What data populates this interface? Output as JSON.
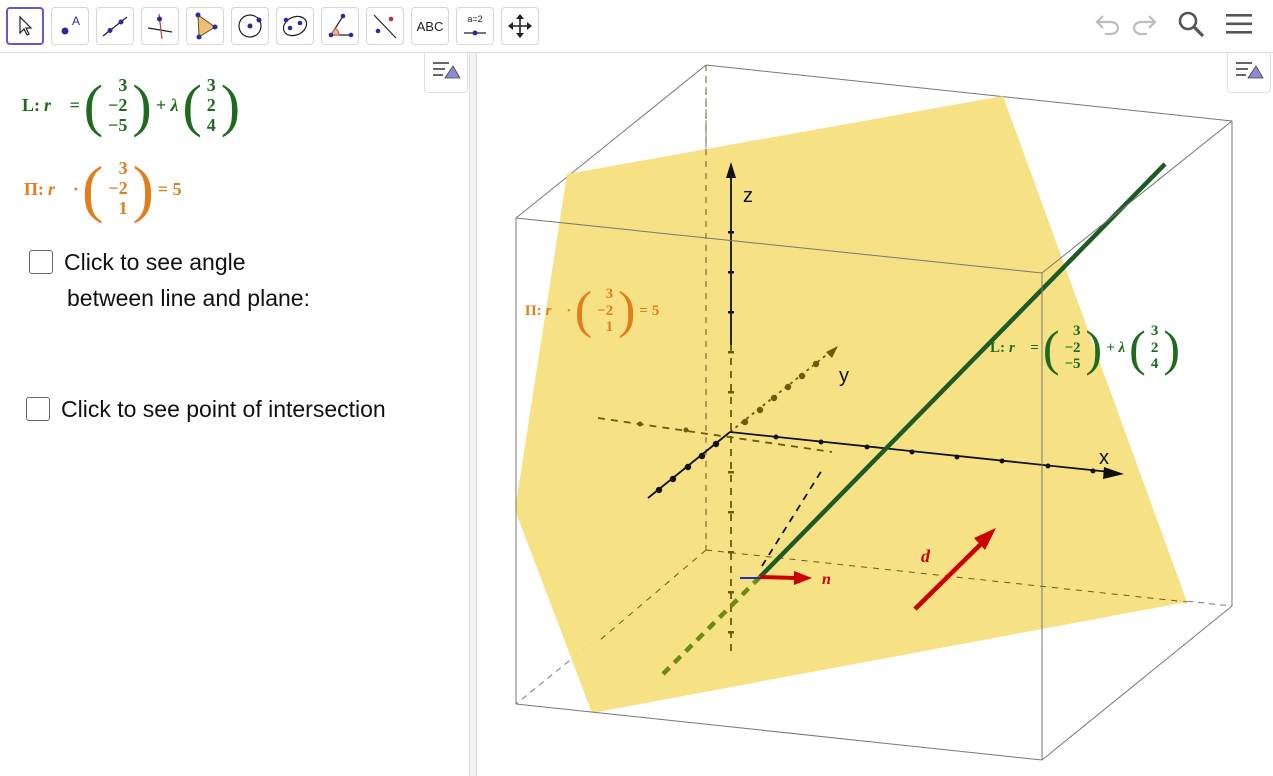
{
  "toolbar": {
    "text_tool_label": "ABC",
    "slider_tool_label": "a=2",
    "point_tool_letter": "A",
    "tools": [
      "move",
      "point",
      "line",
      "perpendicular-line",
      "polygon",
      "circle",
      "conic",
      "angle",
      "reflect",
      "text",
      "slider",
      "move-graphics-view"
    ]
  },
  "algebra": {
    "line": {
      "name": "L:",
      "lhs": "r⃗ =",
      "point": [
        "3",
        "−2",
        "−5"
      ],
      "op": "+ λ",
      "direction": [
        "3",
        "2",
        "4"
      ]
    },
    "plane": {
      "name": "Π:",
      "lhs": "r⃗ ·",
      "normal": [
        "3",
        "−2",
        "1"
      ],
      "rhs": "= 5"
    },
    "checkbox_angle": {
      "label_line1": "Click to see angle",
      "label_line2": "between line and plane:",
      "checked": false
    },
    "checkbox_intersection": {
      "label": "Click to see point of intersection",
      "checked": false
    }
  },
  "graphics3d": {
    "axis_x": "x",
    "axis_y": "y",
    "axis_z": "z",
    "vector_n": "n⃗",
    "vector_d": "d⃗",
    "plane_label": {
      "name": "Π:",
      "lhs": "r⃗ ·",
      "normal": [
        "3",
        "−2",
        "1"
      ],
      "rhs": "= 5"
    },
    "line_label": {
      "name": "L:",
      "lhs": "r⃗ =",
      "point": [
        "3",
        "−2",
        "−5"
      ],
      "op": "+ λ",
      "direction": [
        "3",
        "2",
        "4"
      ]
    }
  },
  "colors": {
    "line": "#1e6b1e",
    "plane_fill": "#f5e07e",
    "plane_label": "#e27d1b",
    "vectors": "#cc0000",
    "active_tool_border": "#6557d2"
  }
}
